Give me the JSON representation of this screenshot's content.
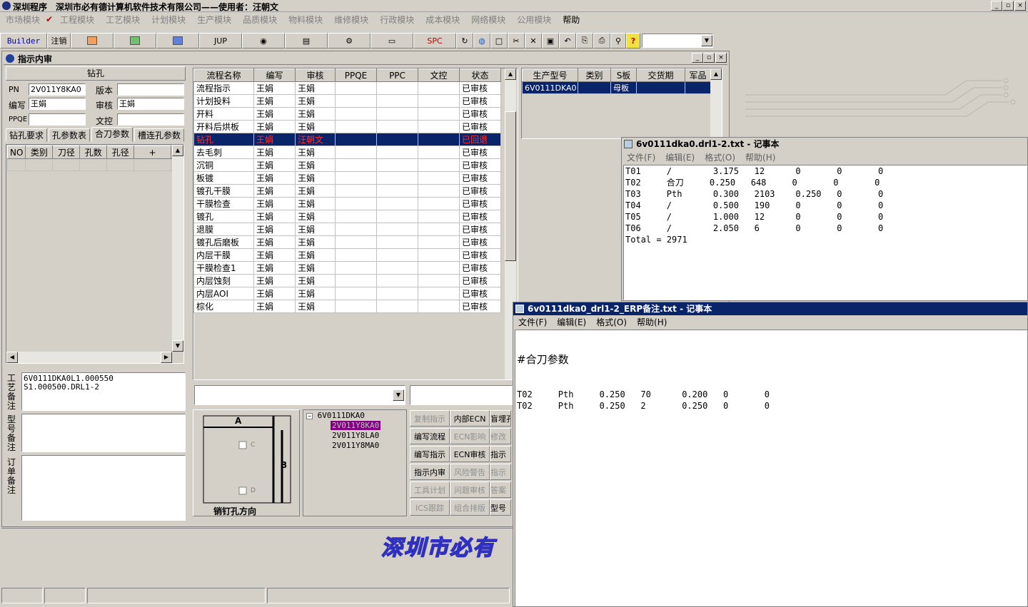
{
  "app": {
    "title": "深圳程序　深圳市必有德计算机软件技术有限公司——使用者：汪朝文"
  },
  "menu": [
    {
      "label": "市场模块",
      "enabled": false
    },
    {
      "label": "工程模块",
      "enabled": false
    },
    {
      "label": "工艺模块",
      "enabled": false
    },
    {
      "label": "计划模块",
      "enabled": false
    },
    {
      "label": "生产模块",
      "enabled": false
    },
    {
      "label": "品质模块",
      "enabled": false
    },
    {
      "label": "物料模块",
      "enabled": false
    },
    {
      "label": "维修模块",
      "enabled": false
    },
    {
      "label": "行政模块",
      "enabled": false
    },
    {
      "label": "成本模块",
      "enabled": false
    },
    {
      "label": "网络模块",
      "enabled": false
    },
    {
      "label": "公用模块",
      "enabled": false
    },
    {
      "label": "帮助",
      "enabled": true
    }
  ],
  "toolbar": {
    "builder": "Builder",
    "logout": "注销",
    "jup": "JUP",
    "spc": "SPC"
  },
  "mdi": {
    "title": "指示内审"
  },
  "drill": {
    "header": "钻孔",
    "pn_label": "PN",
    "pn": "2V011Y8KA0",
    "version_label": "版本",
    "version": "",
    "author_label": "编写",
    "author": "王娟",
    "review_label": "审核",
    "review": "王娟",
    "ppqe_label": "PPQE",
    "ppqe": "",
    "doc_label": "文控",
    "doc": ""
  },
  "tabs": [
    "钻孔要求",
    "孔参数表",
    "合刀参数",
    "槽连孔参数"
  ],
  "hole_columns": [
    "NO",
    "类别",
    "刀径",
    "孔数",
    "孔径",
    "+",
    "−"
  ],
  "process_columns": [
    "流程名称",
    "编写",
    "审核",
    "PPQE",
    "PPC",
    "文控",
    "状态"
  ],
  "process_rows": [
    {
      "name": "流程指示",
      "author": "王娟",
      "review": "王娟",
      "status": "已审核"
    },
    {
      "name": "计划投料",
      "author": "王娟",
      "review": "王娟",
      "status": "已审核"
    },
    {
      "name": "开料",
      "author": "王娟",
      "review": "王娟",
      "status": "已审核"
    },
    {
      "name": "开料后烘板",
      "author": "王娟",
      "review": "王娟",
      "status": "已审核"
    },
    {
      "name": "钻孔",
      "author": "王娟",
      "review": "汪朝文",
      "status": "已回退",
      "selected": true
    },
    {
      "name": "去毛刺",
      "author": "王娟",
      "review": "王娟",
      "status": "已审核"
    },
    {
      "name": "沉铜",
      "author": "王娟",
      "review": "王娟",
      "status": "已审核"
    },
    {
      "name": "板镀",
      "author": "王娟",
      "review": "王娟",
      "status": "已审核"
    },
    {
      "name": "镀孔干膜",
      "author": "王娟",
      "review": "王娟",
      "status": "已审核"
    },
    {
      "name": "干膜检查",
      "author": "王娟",
      "review": "王娟",
      "status": "已审核"
    },
    {
      "name": "镀孔",
      "author": "王娟",
      "review": "王娟",
      "status": "已审核"
    },
    {
      "name": "退膜",
      "author": "王娟",
      "review": "王娟",
      "status": "已审核"
    },
    {
      "name": "镀孔后磨板",
      "author": "王娟",
      "review": "王娟",
      "status": "已审核"
    },
    {
      "name": "内层干膜",
      "author": "王娟",
      "review": "王娟",
      "status": "已审核"
    },
    {
      "name": "干膜检查1",
      "author": "王娟",
      "review": "王娟",
      "status": "已审核"
    },
    {
      "name": "内层蚀刻",
      "author": "王娟",
      "review": "王娟",
      "status": "已审核"
    },
    {
      "name": "内层AOI",
      "author": "王娟",
      "review": "王娟",
      "status": "已审核"
    },
    {
      "name": "棕化",
      "author": "王娟",
      "review": "王娟",
      "status": "已审核"
    }
  ],
  "product_columns": [
    "生产型号",
    "类别",
    "S板",
    "交货期",
    "军品"
  ],
  "product_rows": [
    {
      "model": "6V0111DKA0",
      "type": "",
      "sboard": "母板",
      "due": "",
      "mil": ""
    }
  ],
  "remarks": {
    "process_label": "工艺备注",
    "process_text": "6V0111DKA0L1.000550\nS1.000500.DRL1-2",
    "model_label": "型号备注",
    "order_label": "订单备注"
  },
  "pin": {
    "a": "A",
    "b": "B",
    "c": "C",
    "d": "D",
    "caption": "销钉孔方向"
  },
  "tree": {
    "root": "6V0111DKA0",
    "children": [
      "2V011Y8KA0",
      "2V011Y8LA0",
      "2V011Y8MA0"
    ],
    "selected": 0
  },
  "commands": [
    {
      "label": "复制指示",
      "enabled": false
    },
    {
      "label": "内部ECN",
      "enabled": true
    },
    {
      "label": "盲埋孔",
      "enabled": true
    },
    {
      "label": "编写流程",
      "enabled": true
    },
    {
      "label": "ECN影响",
      "enabled": false
    },
    {
      "label": "修改",
      "enabled": false
    },
    {
      "label": "编写指示",
      "enabled": true
    },
    {
      "label": "ECN审核",
      "enabled": true
    },
    {
      "label": "指示",
      "enabled": true
    },
    {
      "label": "指示内审",
      "enabled": true
    },
    {
      "label": "风险警告",
      "enabled": false
    },
    {
      "label": "指示",
      "enabled": false
    },
    {
      "label": "工具计划",
      "enabled": false
    },
    {
      "label": "问题审核",
      "enabled": false
    },
    {
      "label": "答案",
      "enabled": false
    },
    {
      "label": "ICS跟踪",
      "enabled": false
    },
    {
      "label": "组合排版",
      "enabled": false
    },
    {
      "label": "型号",
      "enabled": true
    }
  ],
  "banner": "深圳市必有",
  "notepad1": {
    "title": "6v0111dka0.drl1-2.txt - 记事本",
    "menu": [
      "文件(F)",
      "编辑(E)",
      "格式(O)",
      "帮助(H)"
    ],
    "lines": [
      "T01     /        3.175   12      0       0       0",
      "T02     合刀     0.250   648     0       0       0",
      "T03     Pth      0.300   2103    0.250   0       0",
      "T04     /        0.500   190     0       0       0",
      "T05     /        1.000   12      0       0       0",
      "T06     /        2.050   6       0       0       0",
      "Total = 2971"
    ]
  },
  "notepad2": {
    "title": "6v0111dka0_drl1-2_ERP备注.txt - 记事本",
    "menu": [
      "文件(F)",
      "编辑(E)",
      "格式(O)",
      "帮助(H)"
    ],
    "heading": "#合刀参数",
    "lines": [
      "T02     Pth     0.250   70      0.200   0       0",
      "T02     Pth     0.250   2       0.250   0       0"
    ]
  },
  "colors": {
    "selection": "#0a246a",
    "error_text": "#ff3030",
    "banner": "#3030c0"
  }
}
